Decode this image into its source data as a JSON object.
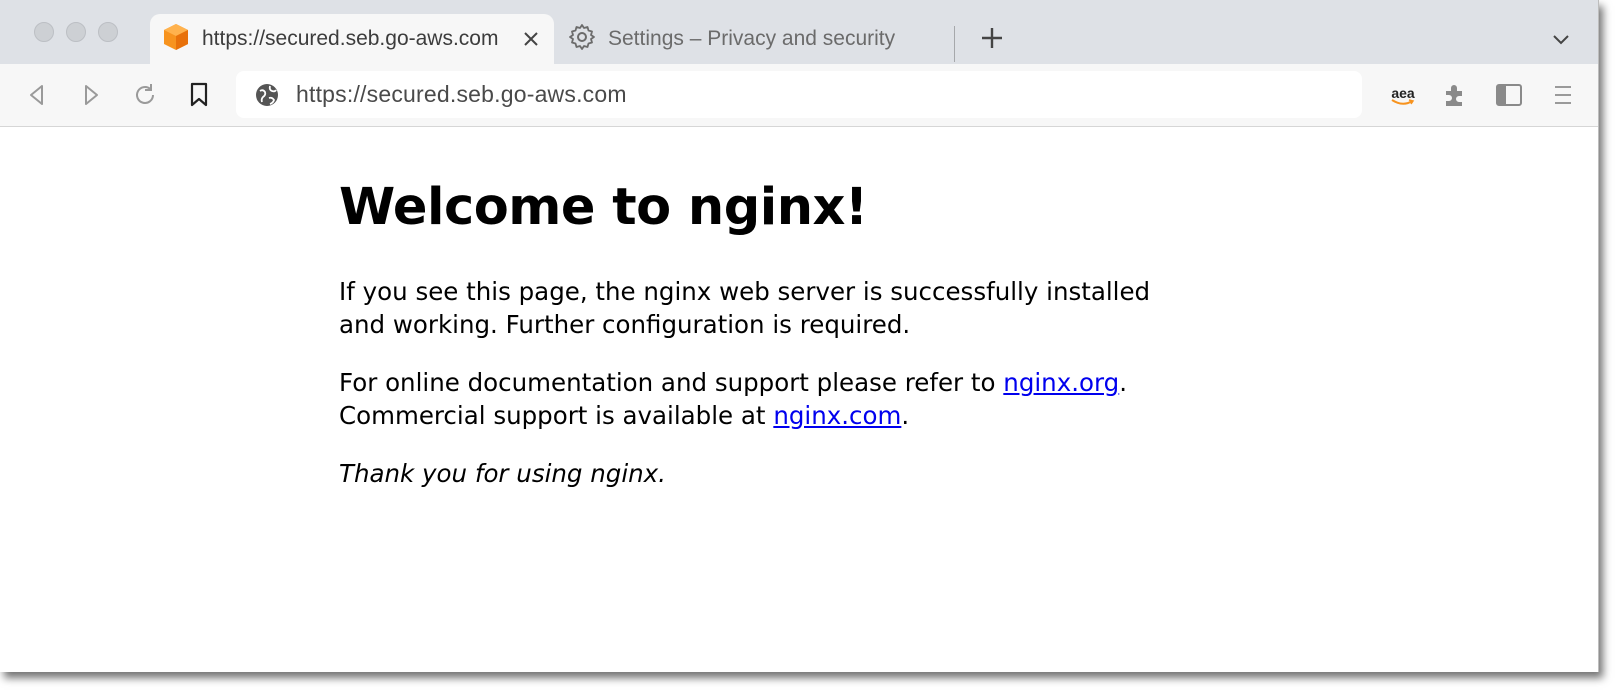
{
  "browser": {
    "tabs": [
      {
        "title": "https://secured.seb.go-aws.com",
        "icon": "orange-cube-favicon-icon",
        "active": true
      },
      {
        "title": "Settings – Privacy and security",
        "icon": "gear-icon",
        "active": false
      }
    ],
    "url": "https://secured.seb.go-aws.com",
    "extension_label": "aea"
  },
  "page": {
    "heading": "Welcome to nginx!",
    "para1": "If you see this page, the nginx web server is successfully installed and working. Further configuration is required.",
    "para2_prefix": "For online documentation and support please refer to ",
    "link_org": "nginx.org",
    "para2_mid": ".",
    "para2_line2": "Commercial support is available at ",
    "link_com": "nginx.com",
    "para2_end": ".",
    "thanks": "Thank you for using nginx."
  },
  "colors": {
    "link": "#0000ee",
    "favicon": "#f7931e",
    "tabstrip": "#dee1e6"
  }
}
